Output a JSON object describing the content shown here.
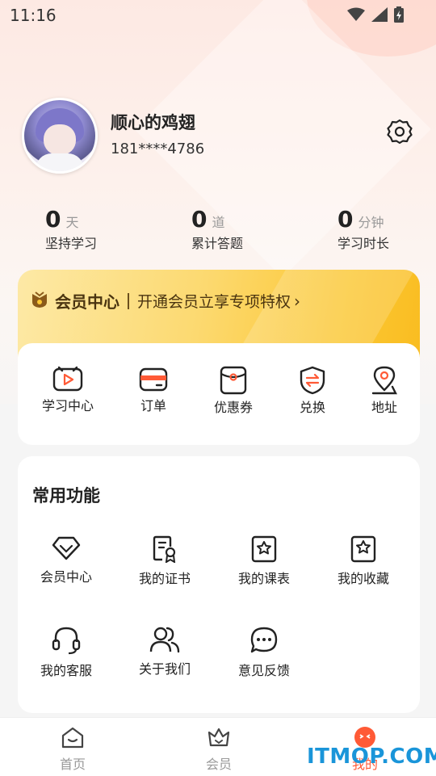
{
  "status_bar": {
    "time": "11:16"
  },
  "profile": {
    "name": "顺心的鸡翅",
    "phone": "181****4786"
  },
  "stats": [
    {
      "value": "0",
      "unit": "天",
      "label": "坚持学习"
    },
    {
      "value": "0",
      "unit": "道",
      "label": "累计答题"
    },
    {
      "value": "0",
      "unit": "分钟",
      "label": "学习时长"
    }
  ],
  "vip": {
    "title": "会员中心",
    "promo": "开通会员立享专项特权",
    "arrow": "›"
  },
  "quick_actions": [
    {
      "label": "学习中心",
      "icon": "play-icon"
    },
    {
      "label": "订单",
      "icon": "wallet-icon"
    },
    {
      "label": "优惠券",
      "icon": "coupon-icon"
    },
    {
      "label": "兑换",
      "icon": "exchange-icon"
    },
    {
      "label": "地址",
      "icon": "location-icon"
    }
  ],
  "common_functions": {
    "title": "常用功能",
    "items": [
      {
        "label": "会员中心",
        "icon": "diamond-icon"
      },
      {
        "label": "我的证书",
        "icon": "certificate-icon"
      },
      {
        "label": "我的课表",
        "icon": "star-badge-icon"
      },
      {
        "label": "我的收藏",
        "icon": "bookmark-star-icon"
      },
      {
        "label": "我的客服",
        "icon": "headset-icon"
      },
      {
        "label": "关于我们",
        "icon": "users-icon"
      },
      {
        "label": "意见反馈",
        "icon": "chat-bubble-icon"
      }
    ]
  },
  "tab_bar": [
    {
      "label": "首页",
      "icon": "home-icon"
    },
    {
      "label": "会员",
      "icon": "crown-icon"
    },
    {
      "label": "我的",
      "icon": "face-icon",
      "active": true
    }
  ],
  "watermark": "ITMOP.COM",
  "colors": {
    "accent": "#ff5a36",
    "gold": "#fbc733",
    "text": "#222222"
  }
}
